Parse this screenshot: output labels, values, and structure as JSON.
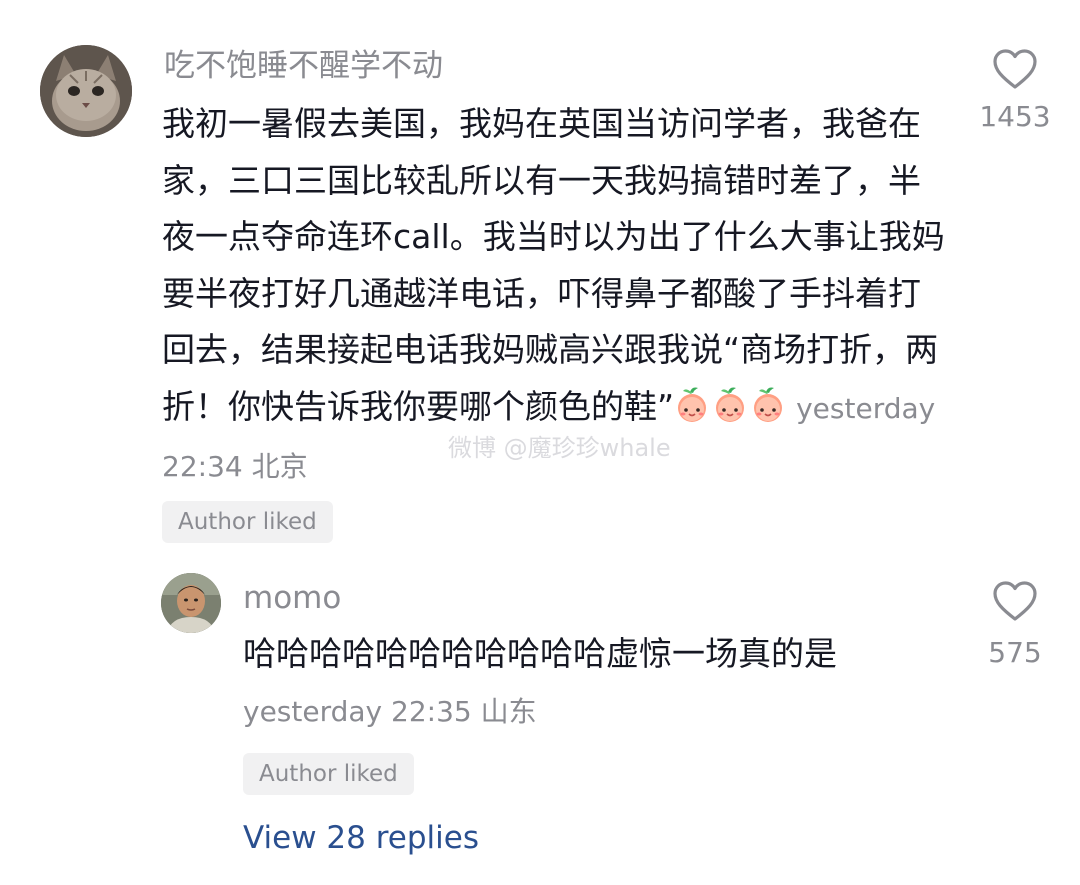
{
  "main_comment": {
    "username": "吃不饱睡不醒学不动",
    "text": "我初一暑假去美国，我妈在英国当访问学者，我爸在家，三口三国比较乱所以有一天我妈搞错时差了，半夜一点夺命连环call。我当时以为出了什么大事让我妈要半夜打好几通越洋电话，吓得鼻子都酸了手抖着打回去，结果接起电话我妈贼高兴跟我说“商场打折，两折！你快告诉我你要哪个颜色的鞋”",
    "emojis": [
      "peach-face-emoji",
      "peach-face-emoji",
      "peach-face-emoji"
    ],
    "timestamp": "yesterday 22:34",
    "location": "北京",
    "like_count": "1453",
    "author_liked": "Author liked"
  },
  "reply": {
    "username": "momo",
    "text": "哈哈哈哈哈哈哈哈哈哈哈虚惊一场真的是",
    "timestamp": "yesterday 22:35",
    "location": "山东",
    "like_count": "575",
    "author_liked": "Author liked"
  },
  "view_replies": "View 28 replies",
  "watermark": "微博 @魔珍珍whale",
  "colors": {
    "text_primary": "#161823",
    "text_secondary": "#8a8b91",
    "link": "#2a4f8f",
    "badge_bg": "#f1f1f2"
  }
}
